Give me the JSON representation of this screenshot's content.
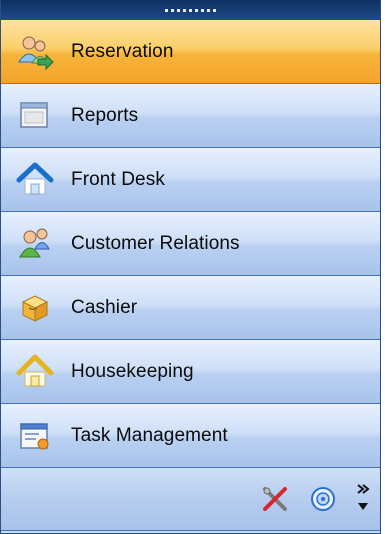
{
  "nav": {
    "items": [
      {
        "label": "Reservation",
        "icon": "people-arrow-icon",
        "active": true
      },
      {
        "label": "Reports",
        "icon": "report-window-icon",
        "active": false
      },
      {
        "label": "Front Desk",
        "icon": "house-blue-icon",
        "active": false
      },
      {
        "label": "Customer Relations",
        "icon": "people-icon",
        "active": false
      },
      {
        "label": "Cashier",
        "icon": "cash-box-icon",
        "active": false
      },
      {
        "label": "Housekeeping",
        "icon": "house-yellow-icon",
        "active": false
      },
      {
        "label": "Task Management",
        "icon": "task-window-icon",
        "active": false
      }
    ]
  },
  "toolbar": {
    "buttons": [
      "tools-icon",
      "settings-disc-icon",
      "overflow-chevron-icon"
    ]
  },
  "colors": {
    "active_start": "#fde2a1",
    "active_end": "#f4a22a",
    "item_start": "#e7f0fd",
    "item_end": "#a7c3ec",
    "header": "#0f2f63",
    "border": "#4773b7"
  }
}
